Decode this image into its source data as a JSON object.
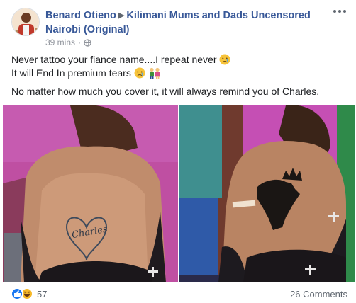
{
  "post": {
    "author": "Benard Otieno",
    "group": "Kilimani Mums and Dads Uncensored Nairobi (Original)",
    "time": "39 mins",
    "privacy_icon": "globe-icon",
    "lines": [
      "Never tattoo your fiance name....I repeat never",
      "It will End In premium tears",
      "No matter how much you cover it, it will always remind you of Charles."
    ],
    "tattoo_text": "Charles"
  },
  "footer": {
    "reaction_count": "57",
    "comments": "26 Comments"
  },
  "colors": {
    "link": "#385898",
    "like": "#1877f2",
    "haha": "#f7b928"
  }
}
